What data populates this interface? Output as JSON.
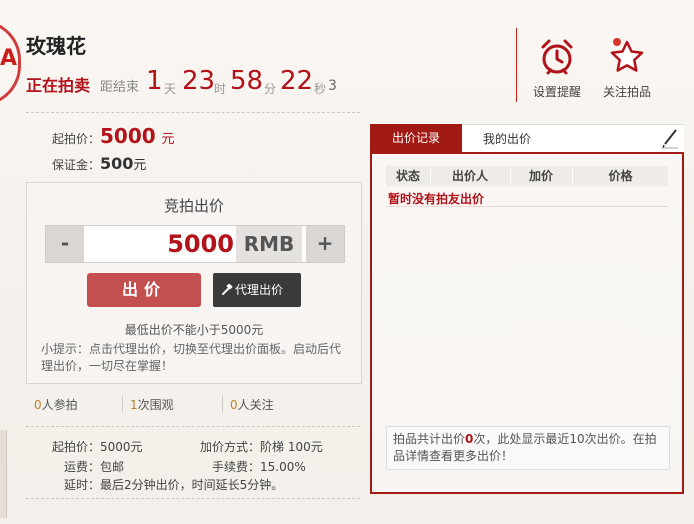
{
  "item": {
    "title": "玫瑰花",
    "status": "正在拍卖"
  },
  "countdown": {
    "label": "距结束",
    "days": "1",
    "days_unit": "天",
    "hours": "23",
    "hours_unit": "时",
    "minutes": "58",
    "minutes_unit": "分",
    "seconds": "22",
    "seconds_unit": "秒",
    "tenths": "3"
  },
  "actions": {
    "reminder": "设置提醒",
    "follow": "关注拍品"
  },
  "pricing": {
    "start_label": "起拍价：",
    "start_value": "5000",
    "start_unit": "元",
    "deposit_label": "保证金：",
    "deposit_value": "500",
    "deposit_unit": "元"
  },
  "bid": {
    "header": "竞拍出价",
    "minus": "-",
    "plus": "+",
    "amount": "5000",
    "currency": "RMB",
    "submit_label": "出价",
    "proxy_label": "代理出价",
    "min_hint": "最低出价不能小于5000元",
    "tip": "小提示：点击代理出价，切换至代理出价面板。启动后代理出价，一切尽在掌握！"
  },
  "stats": {
    "participants_count": "0",
    "participants_label": "人参拍",
    "views_count": "1",
    "views_label": "次围观",
    "follows_count": "0",
    "follows_label": "人关注"
  },
  "details": {
    "start_price_label": "起拍价：",
    "start_price_value": "5000元",
    "increment_label": "加价方式：",
    "increment_value": "阶梯 100元",
    "shipping_label": "运费：",
    "shipping_value": "包邮",
    "fee_label": "手续费：",
    "fee_value": "15.00%",
    "delay_label": "延时：",
    "delay_value": "最后2分钟出价，时间延长5分钟。"
  },
  "records": {
    "tabs": [
      {
        "label": "出价记录"
      },
      {
        "label": "我的出价"
      }
    ],
    "columns": [
      "状态",
      "出价人",
      "加价",
      "价格"
    ],
    "empty_message": "暂时没有拍友出价",
    "footer_prefix": "拍品共计出价",
    "footer_count": "0",
    "footer_suffix": "次，此处显示最近10次出价。在拍品详情查看更多出价！"
  },
  "colors": {
    "accent": "#b2121a",
    "tab_active": "#a11a14",
    "bid_button": "#c44f4f",
    "proxy_button": "#3a3a3a",
    "stat_number": "#c0832b"
  }
}
